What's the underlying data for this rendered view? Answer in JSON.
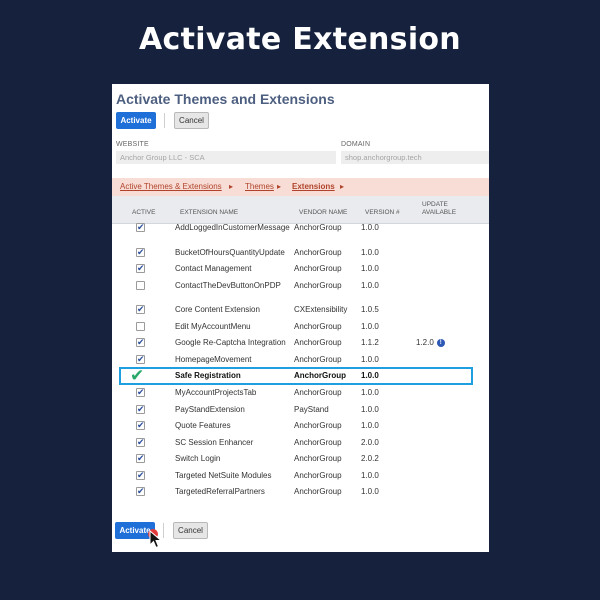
{
  "headline": "Activate Extension",
  "panel": {
    "title": "Activate Themes and Extensions",
    "activate_label": "Activate",
    "cancel_label": "Cancel",
    "website_label": "WEBSITE",
    "website_value": "Anchor Group LLC - SCA",
    "domain_label": "DOMAIN",
    "domain_value": "shop.anchorgroup.tech"
  },
  "breadcrumb": {
    "item1": "Active Themes & Extensions",
    "item2": "Themes",
    "item3": "Extensions",
    "caret": "▸"
  },
  "table": {
    "headers": {
      "active": "ACTIVE",
      "name": "EXTENSION NAME",
      "vendor": "VENDOR NAME",
      "version": "VERSION #",
      "update_l1": "UPDATE",
      "update_l2": "AVAILABLE"
    },
    "rows": [
      {
        "active": true,
        "name": "AddLoggedInCustomerMessage",
        "vendor": "AnchorGroup",
        "version": "1.0.0",
        "update": ""
      },
      {
        "active": true,
        "name": "BucketOfHoursQuantityUpdate",
        "vendor": "AnchorGroup",
        "version": "1.0.0",
        "update": ""
      },
      {
        "active": true,
        "name": "Contact Management",
        "vendor": "AnchorGroup",
        "version": "1.0.0",
        "update": ""
      },
      {
        "active": false,
        "name": "ContactTheDevButtonOnPDP",
        "vendor": "AnchorGroup",
        "version": "1.0.0",
        "update": ""
      },
      {
        "active": true,
        "name": "Core Content Extension",
        "vendor": "CXExtensibility",
        "version": "1.0.5",
        "update": ""
      },
      {
        "active": false,
        "name": "Edit MyAccountMenu",
        "vendor": "AnchorGroup",
        "version": "1.0.0",
        "update": ""
      },
      {
        "active": true,
        "name": "Google Re-Captcha Integration",
        "vendor": "AnchorGroup",
        "version": "1.1.2",
        "update": "1.2.0"
      },
      {
        "active": true,
        "name": "HomepageMovement",
        "vendor": "AnchorGroup",
        "version": "1.0.0",
        "update": ""
      },
      {
        "active": true,
        "name": "Safe Registration",
        "vendor": "AnchorGroup",
        "version": "1.0.0",
        "update": ""
      },
      {
        "active": true,
        "name": "MyAccountProjectsTab",
        "vendor": "AnchorGroup",
        "version": "1.0.0",
        "update": ""
      },
      {
        "active": true,
        "name": "PayStandExtension",
        "vendor": "PayStand",
        "version": "1.0.0",
        "update": ""
      },
      {
        "active": true,
        "name": "Quote Features",
        "vendor": "AnchorGroup",
        "version": "1.0.0",
        "update": ""
      },
      {
        "active": true,
        "name": "SC Session Enhancer",
        "vendor": "AnchorGroup",
        "version": "2.0.0",
        "update": ""
      },
      {
        "active": true,
        "name": "Switch Login",
        "vendor": "AnchorGroup",
        "version": "2.0.2",
        "update": ""
      },
      {
        "active": true,
        "name": "Targeted NetSuite Modules",
        "vendor": "AnchorGroup",
        "version": "1.0.0",
        "update": ""
      },
      {
        "active": true,
        "name": "TargetedReferralPartners",
        "vendor": "AnchorGroup",
        "version": "1.0.0",
        "update": ""
      }
    ]
  },
  "footer": {
    "activate_label": "Activate",
    "cancel_label": "Cancel"
  },
  "colors": {
    "background": "#16223d",
    "primary_button": "#1f6fd9",
    "highlight_border": "#1e9fe0",
    "check_green": "#2aa86a",
    "breadcrumb_bg": "#f7ddd5",
    "breadcrumb_text": "#b0432b"
  }
}
